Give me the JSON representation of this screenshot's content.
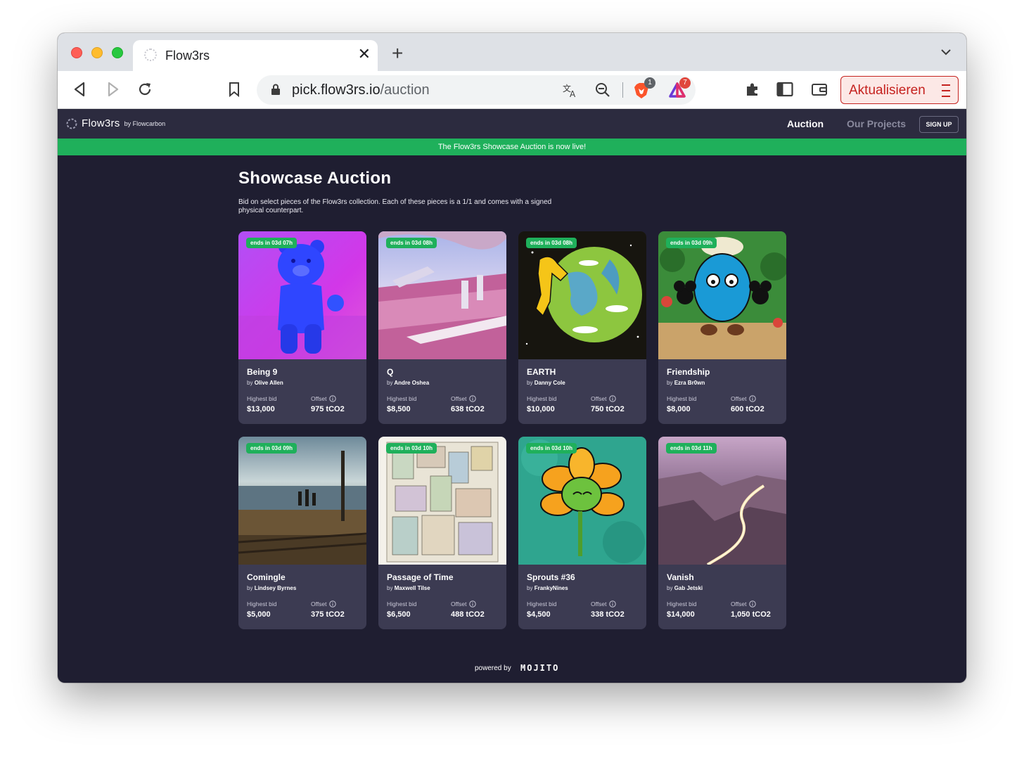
{
  "browser": {
    "tab_title": "Flow3rs",
    "url_host": "pick.flow3rs.io",
    "url_path": "/auction",
    "brave_badge": "1",
    "rewards_badge": "7",
    "update_label": "Aktualisieren"
  },
  "site": {
    "logo_text": "Flow3rs",
    "logo_by": "by Flowcarbon",
    "nav": {
      "auction": "Auction",
      "projects": "Our Projects",
      "signup": "SIGN UP"
    },
    "announcement": "The Flow3rs Showcase Auction is now live!",
    "title": "Showcase Auction",
    "description": "Bid on select pieces of the Flow3rs collection. Each of these pieces is a 1/1 and comes with a signed physical counterpart.",
    "powered_by": "powered by",
    "powered_brand": "MOJITO"
  },
  "labels": {
    "by": "by",
    "highest_bid": "Highest bid",
    "offset": "Offset"
  },
  "cards": [
    {
      "ends": "ends in 03d 07h",
      "title": "Being 9",
      "artist": "Olive Allen",
      "bid": "$13,000",
      "offset": "975 tCO2"
    },
    {
      "ends": "ends in 03d 08h",
      "title": "Q",
      "artist": "Andre Oshea",
      "bid": "$8,500",
      "offset": "638 tCO2"
    },
    {
      "ends": "ends in 03d 08h",
      "title": "EARTH",
      "artist": "Danny Cole",
      "bid": "$10,000",
      "offset": "750 tCO2"
    },
    {
      "ends": "ends in 03d 09h",
      "title": "Friendship",
      "artist": "Ezra Br0wn",
      "bid": "$8,000",
      "offset": "600 tCO2"
    },
    {
      "ends": "ends in 03d 09h",
      "title": "Comingle",
      "artist": "Lindsey Byrnes",
      "bid": "$5,000",
      "offset": "375 tCO2"
    },
    {
      "ends": "ends in 03d 10h",
      "title": "Passage of Time",
      "artist": "Maxwell Tilse",
      "bid": "$6,500",
      "offset": "488 tCO2"
    },
    {
      "ends": "ends in 03d 10h",
      "title": "Sprouts #36",
      "artist": "FrankyNines",
      "bid": "$4,500",
      "offset": "338 tCO2"
    },
    {
      "ends": "ends in 03d 11h",
      "title": "Vanish",
      "artist": "Gab Jetski",
      "bid": "$14,000",
      "offset": "1,050 tCO2"
    }
  ]
}
